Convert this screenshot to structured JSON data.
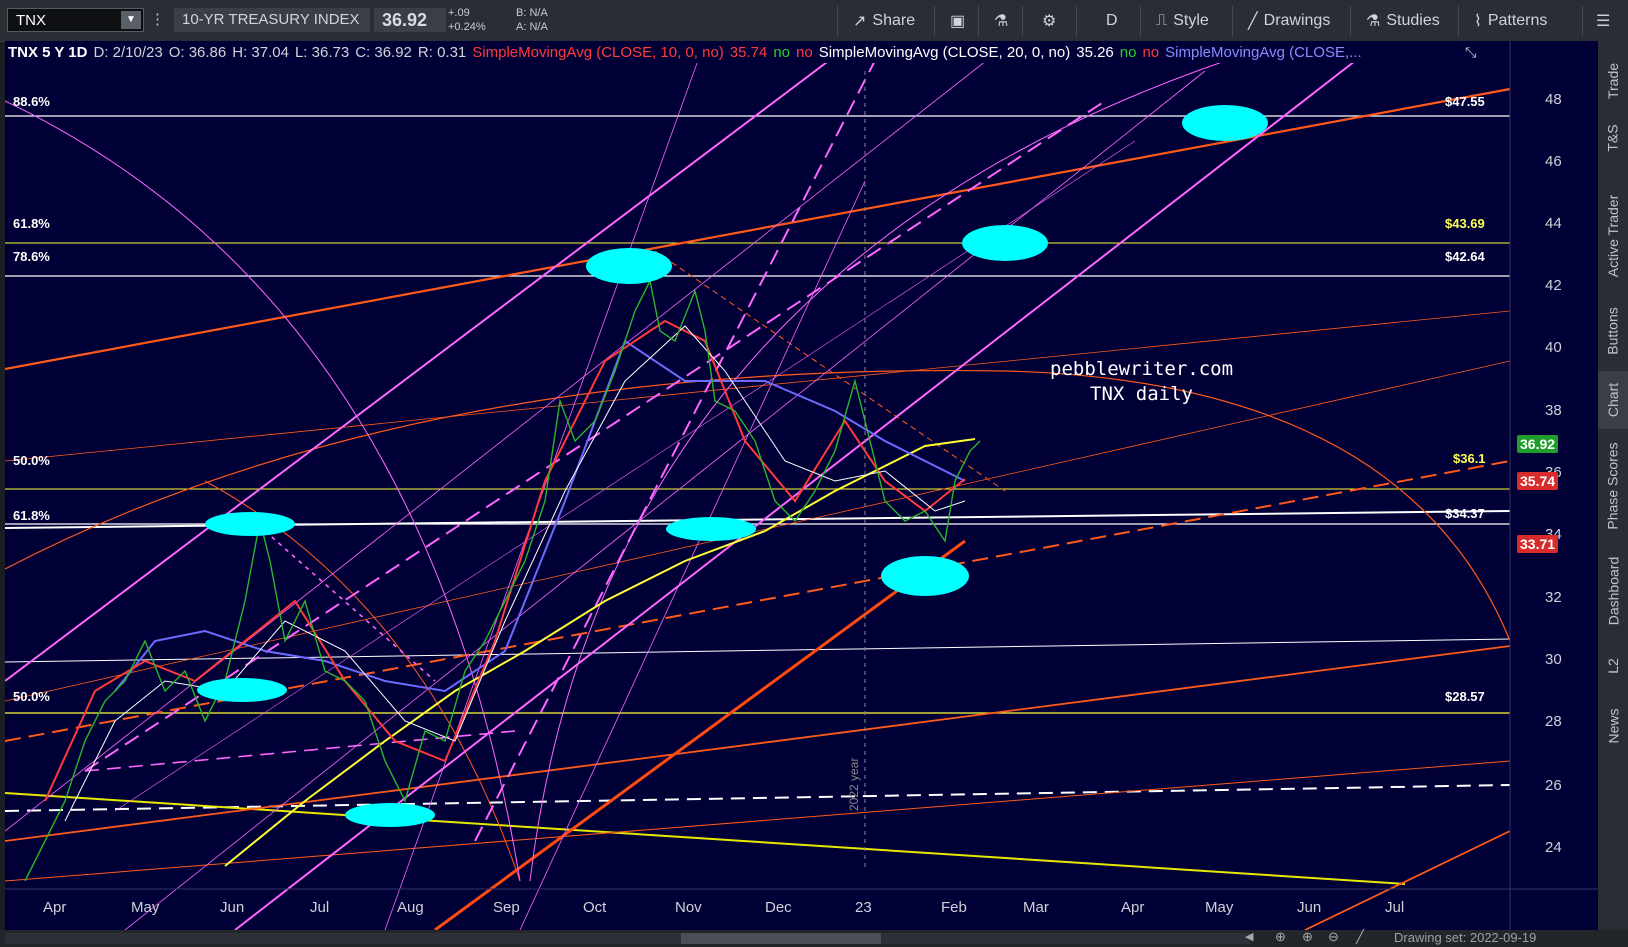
{
  "toolbar": {
    "symbol": "TNX",
    "instrument_name": "10-YR TREASURY INDEX",
    "last_price": "36.92",
    "change": "+.09",
    "change_pct": "+0.24%",
    "bid": "B: N/A",
    "ask": "A: N/A",
    "share": "Share",
    "aggregation": "D",
    "style": "Style",
    "drawings": "Drawings",
    "studies": "Studies",
    "patterns": "Patterns"
  },
  "info": {
    "symbol_period": "TNX 5 Y 1D",
    "date": "D: 2/10/23",
    "open": "O: 36.86",
    "high": "H: 37.04",
    "low": "L: 36.73",
    "close": "C: 36.92",
    "range": "R: 0.31",
    "sma1": "SimpleMovingAvg (CLOSE, 10, 0, no)",
    "sma1_val": "35.74",
    "sma1_flag1": "no",
    "sma1_flag2": "no",
    "sma2": "SimpleMovingAvg (CLOSE, 20, 0, no)",
    "sma2_val": "35.26",
    "sma2_flag1": "no",
    "sma2_flag2": "no",
    "sma3": "SimpleMovingAvg (CLOSE,..."
  },
  "chart": {
    "y_ticks": [
      "48",
      "46",
      "44",
      "42",
      "40",
      "38",
      "36",
      "34",
      "32",
      "30",
      "28",
      "26",
      "24"
    ],
    "x_ticks": [
      "Apr",
      "May",
      "Jun",
      "Jul",
      "Aug",
      "Sep",
      "Oct",
      "Nov",
      "Dec",
      "23",
      "Feb",
      "Mar",
      "Apr",
      "May",
      "Jun",
      "Jul"
    ],
    "fib_left": {
      "l886": "88.6%",
      "l618a": "61.8%",
      "l786": "78.6%",
      "l500a": "50.0%",
      "l618b": "61.8%",
      "l500b": "50.0%"
    },
    "fib_right": {
      "p4755": "$47.55",
      "p4369": "$43.69",
      "p4264": "$42.64",
      "p361": "$36.1",
      "p3437": "$34.37",
      "p2857": "$28.57"
    },
    "price_tags": {
      "last": "36.92",
      "sma": "35.74",
      "low": "33.71"
    },
    "colors": {
      "last": "#1f9e2c",
      "sma": "#d92b2b",
      "low": "#d92b2b",
      "background": "#000036"
    },
    "watermark_1": "pebblewriter.com",
    "watermark_2": "TNX daily",
    "year_marker": "2022 year"
  },
  "sidebar": [
    "Trade",
    "T&S",
    "Active Trader",
    "Buttons",
    "Chart",
    "Phase Scores",
    "Dashboard",
    "L2",
    "News"
  ],
  "bottom": {
    "drawing_set": "Drawing set: 2022-09-19"
  }
}
